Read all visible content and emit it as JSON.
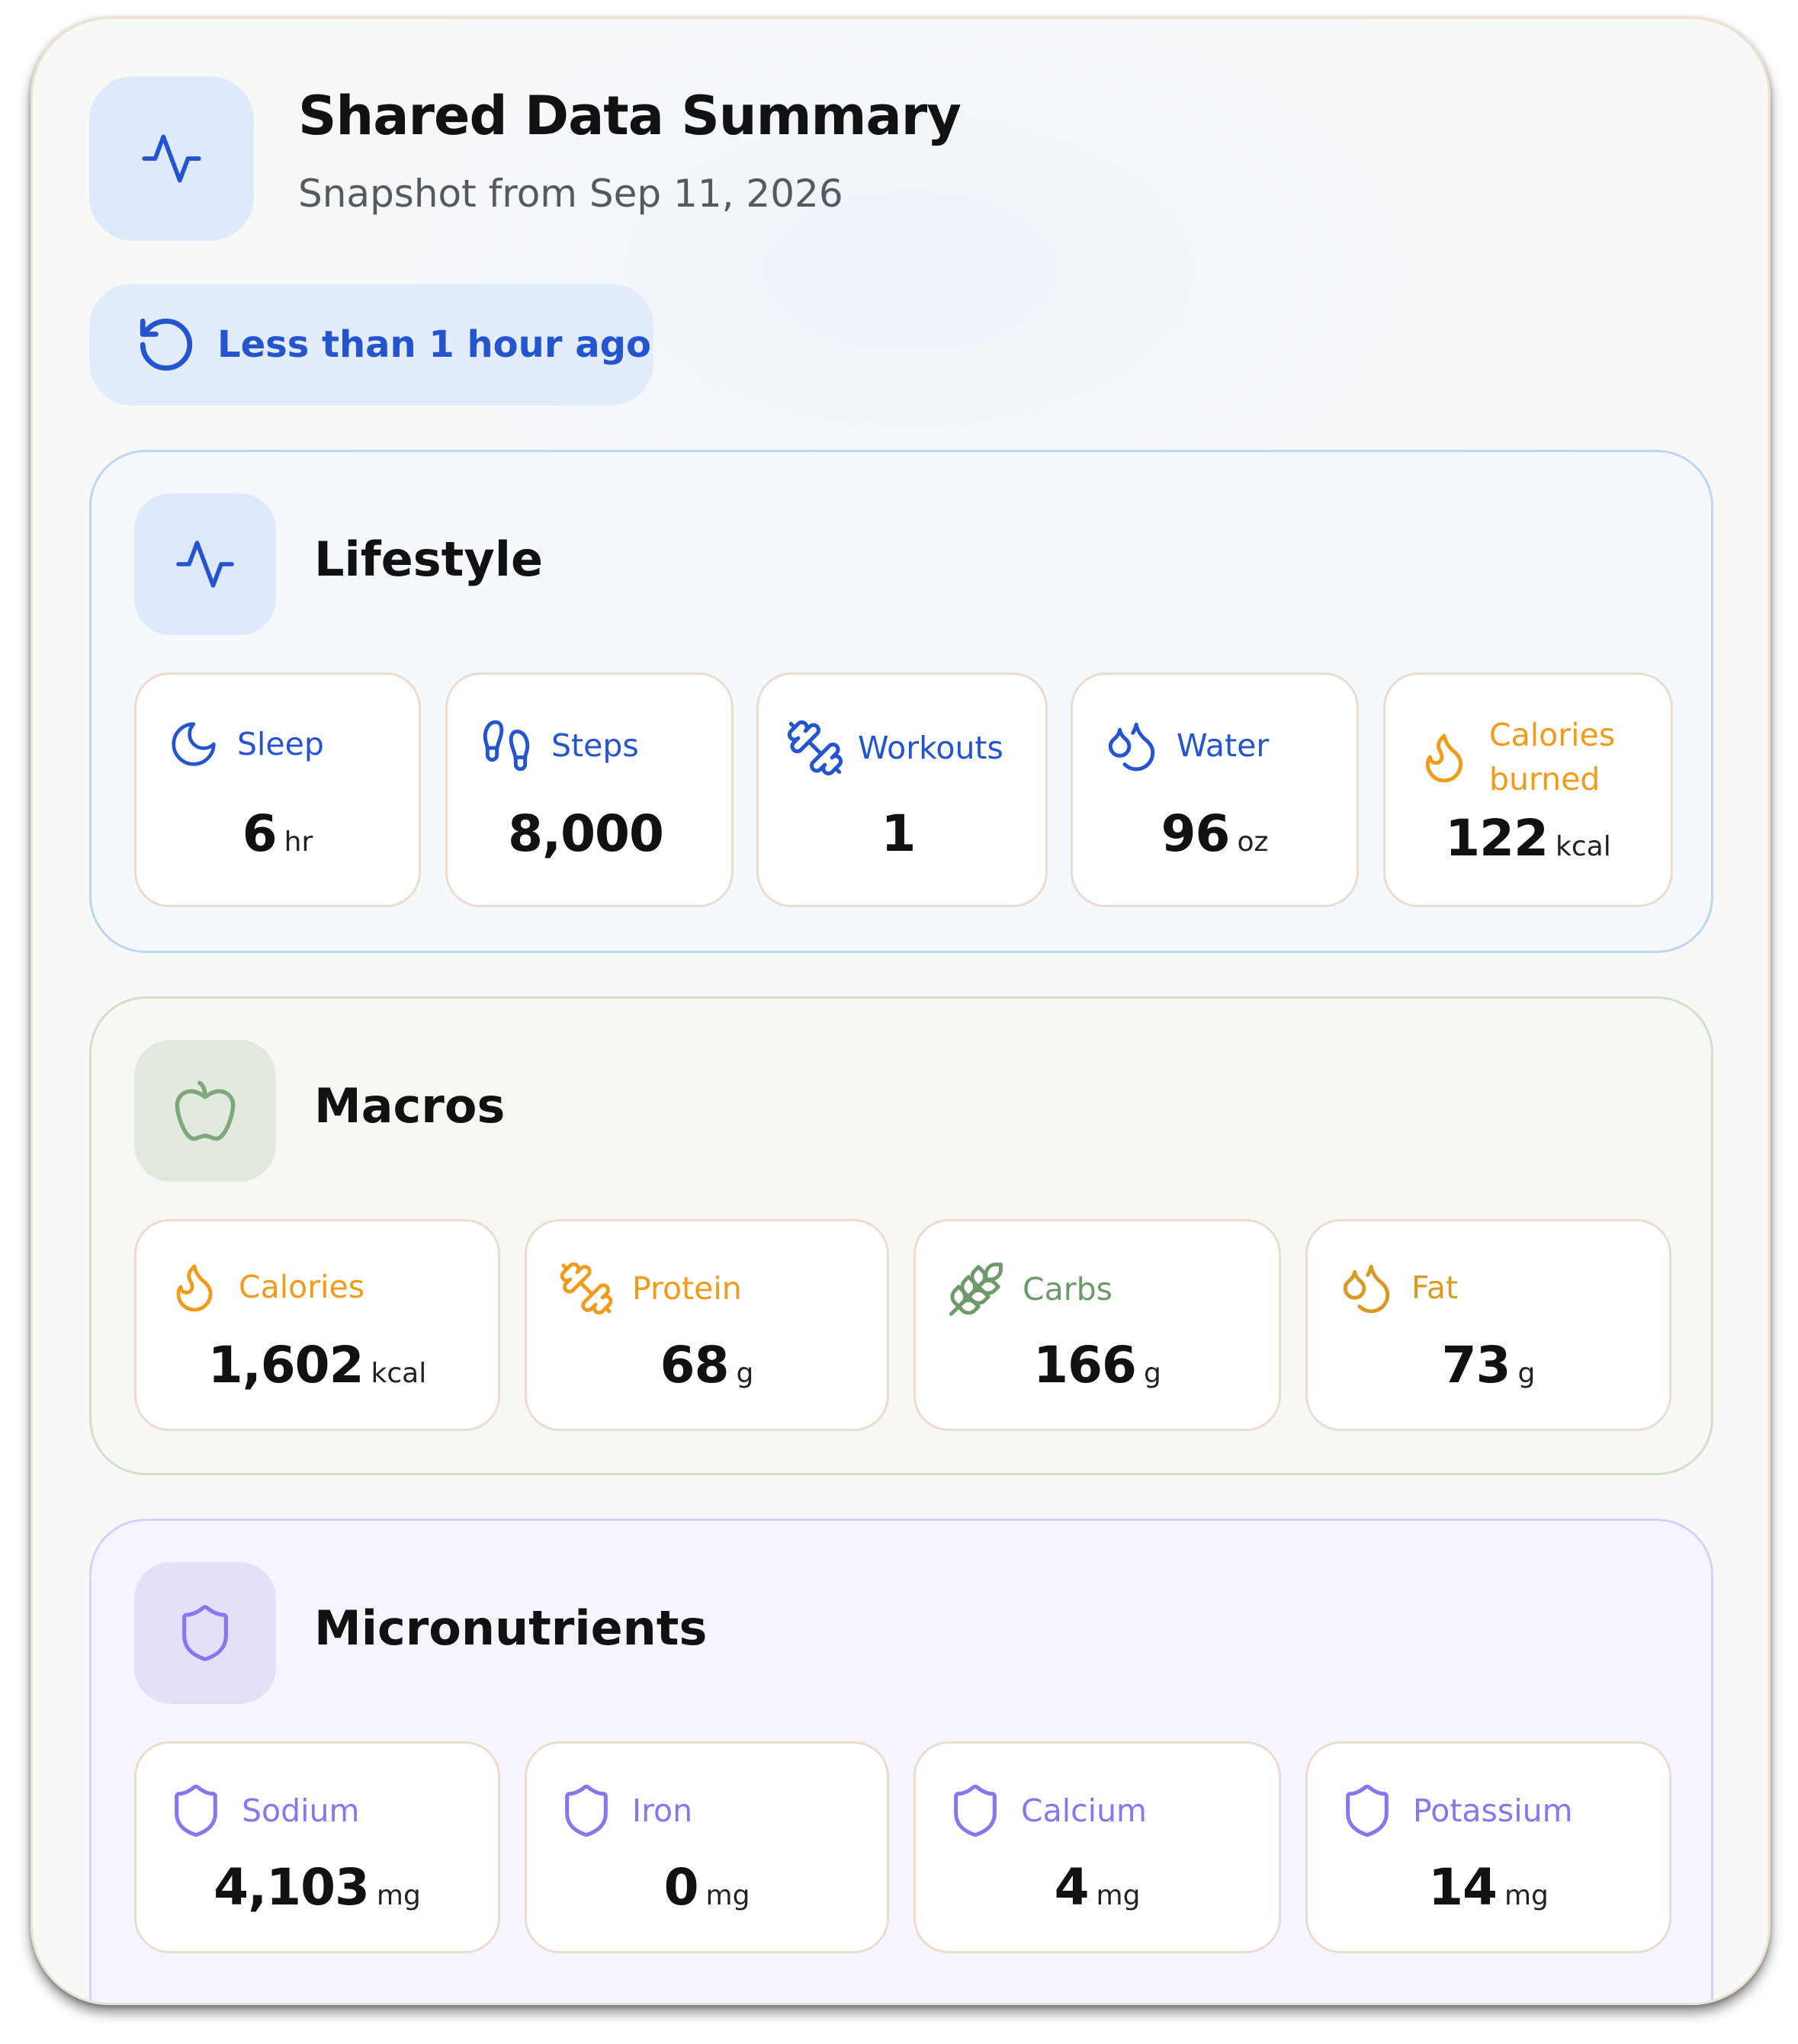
{
  "header": {
    "title": "Shared Data Summary",
    "subtitle": "Snapshot from Sep 11, 2026",
    "icon": "activity-pulse-icon"
  },
  "sync_status": {
    "label": "Less than 1 hour ago",
    "icon": "refresh-icon"
  },
  "colors": {
    "blue": "#2455cf",
    "orange": "#f09b1a",
    "green": "#6e9a6a",
    "purple": "#8577ee"
  },
  "sections": {
    "lifestyle": {
      "title": "Lifestyle",
      "icon": "activity-pulse-icon",
      "items": [
        {
          "label": "Sleep",
          "value": "6",
          "unit": "hr",
          "icon": "moon-icon"
        },
        {
          "label": "Steps",
          "value": "8,000",
          "unit": "",
          "icon": "footprints-icon"
        },
        {
          "label": "Workouts",
          "value": "1",
          "unit": "",
          "icon": "dumbbell-icon"
        },
        {
          "label": "Water",
          "value": "96",
          "unit": "oz",
          "icon": "droplets-icon"
        },
        {
          "label_line1": "Calories",
          "label_line2": "burned",
          "value": "122",
          "unit": "kcal",
          "icon": "flame-icon"
        }
      ]
    },
    "macros": {
      "title": "Macros",
      "icon": "apple-icon",
      "items": [
        {
          "label": "Calories",
          "value": "1,602",
          "unit": "kcal",
          "icon": "flame-icon"
        },
        {
          "label": "Protein",
          "value": "68",
          "unit": "g",
          "icon": "dumbbell-icon"
        },
        {
          "label": "Carbs",
          "value": "166",
          "unit": "g",
          "icon": "wheat-icon"
        },
        {
          "label": "Fat",
          "value": "73",
          "unit": "g",
          "icon": "droplets-icon"
        }
      ]
    },
    "micronutrients": {
      "title": "Micronutrients",
      "icon": "shield-icon",
      "items": [
        {
          "label": "Sodium",
          "value": "4,103",
          "unit": "mg",
          "icon": "shield-icon"
        },
        {
          "label": "Iron",
          "value": "0",
          "unit": "mg",
          "icon": "shield-icon"
        },
        {
          "label": "Calcium",
          "value": "4",
          "unit": "mg",
          "icon": "shield-icon"
        },
        {
          "label": "Potassium",
          "value": "14",
          "unit": "mg",
          "icon": "shield-icon"
        }
      ]
    }
  }
}
